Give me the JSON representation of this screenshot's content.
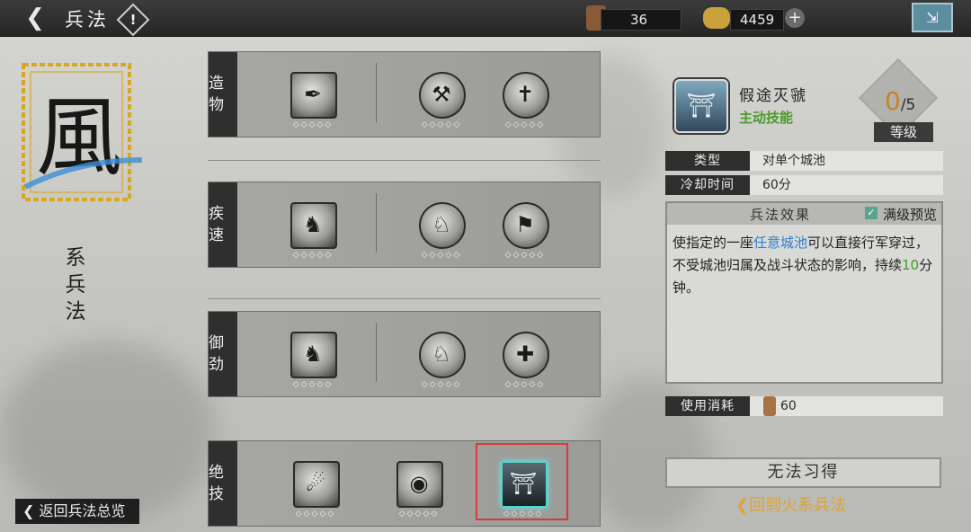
{
  "header": {
    "back_icon": "chevron-left-icon",
    "title": "兵法",
    "help_label": "!",
    "resource1_value": "36",
    "resource2_value": "4459",
    "plus_label": "+",
    "corner_label": "⇲"
  },
  "faction": {
    "logo_char": "風",
    "label": "系兵法",
    "return_label": "返回兵法总览"
  },
  "tree": {
    "rows": [
      {
        "label": "造物",
        "stars": "◇◇◇◇◇"
      },
      {
        "label": "疾速",
        "stars": "◇◇◇◇◇"
      },
      {
        "label": "御劲",
        "stars": "◇◇◇◇◇"
      },
      {
        "label": "绝技",
        "stars": "◇◇◇◇◇"
      }
    ]
  },
  "detail": {
    "name": "假途灭虢",
    "kind": "主动技能",
    "level_current": "0",
    "level_max": "/5",
    "level_tag": "等级",
    "type_key": "类型",
    "type_value": "对单个城池",
    "cooldown_key": "冷却时间",
    "cooldown_value": "60分",
    "effect_title": "兵法效果",
    "max_preview_label": "满级预览",
    "effect_p1": "使指定的一座",
    "effect_hl1": "任意城池",
    "effect_p2": "可以直接行军穿过，不受城池归属及战斗状态的影响，持续",
    "effect_hl2": "10",
    "effect_p3": "分钟。",
    "cost_key": "使用消耗",
    "cost_value": "60",
    "learn_label": "无法习得",
    "fire_link_label": "回到火系兵法"
  },
  "colors": {
    "accent_blue": "#2e7fd0",
    "accent_green": "#3c9a29",
    "accent_gold": "#e0a233",
    "selection_red": "#d83a3a"
  }
}
